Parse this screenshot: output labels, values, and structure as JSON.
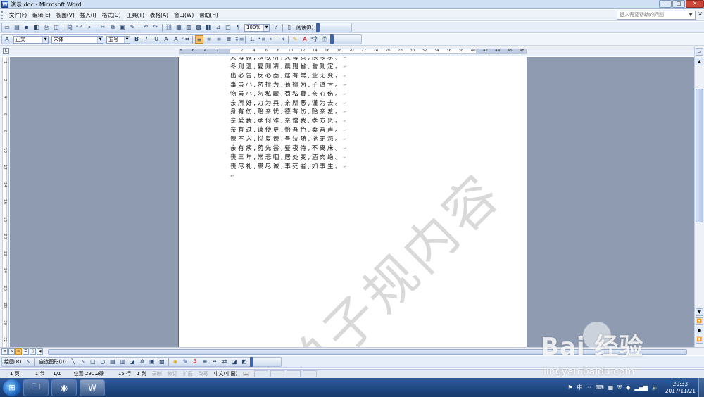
{
  "window": {
    "title": "演示.doc - Microsoft Word",
    "min": "–",
    "max": "□",
    "close": "✕"
  },
  "menu": {
    "items": [
      "文件(F)",
      "编辑(E)",
      "视图(V)",
      "插入(I)",
      "格式(O)",
      "工具(T)",
      "表格(A)",
      "窗口(W)",
      "帮助(H)"
    ],
    "help_placeholder": "键入需要帮助的问题",
    "close": "×"
  },
  "toolbar_standard": {
    "zoom": "100%",
    "read_label": "阅读(R)",
    "simp_trad": "简"
  },
  "toolbar_format": {
    "style": "正文",
    "font": "宋体",
    "size": "五号"
  },
  "ruler": {
    "ticks": [
      "8",
      "6",
      "4",
      "2",
      "",
      "2",
      "4",
      "6",
      "8",
      "10",
      "12",
      "14",
      "16",
      "18",
      "20",
      "22",
      "24",
      "26",
      "28",
      "30",
      "32",
      "34",
      "36",
      "38",
      "40",
      "42",
      "44",
      "46",
      "48"
    ]
  },
  "vruler": {
    "ticks": [
      "1",
      "2",
      "4",
      "6",
      "8",
      "10",
      "12",
      "14",
      "16",
      "18",
      "20",
      "22",
      "24",
      "26",
      "28",
      "30",
      "32"
    ]
  },
  "document": {
    "lines": [
      "父母教,须敬听,父母责,须顺承。",
      "冬则温,夏则凊,晨则省,昏则定。",
      "出必告,反必面,居有常,业无变。",
      "事虽小,勿擅为,苟擅为,子道亏。",
      "物虽小,勿私藏,苟私藏,亲心伤。",
      "亲所好,力为具,亲所恶,谨为去。",
      "身有伤,贻亲忧,德有伤,贻亲羞。",
      "亲爱我,孝何难,亲憎我,孝方贤。",
      "亲有过,谏使更,怡吾色,柔吾声。",
      "谏不入,悦复谏,号泣随,挞无怨。",
      "亲有疾,药先尝,昼夜侍,不离床。",
      "丧三年,常悲咽,居处变,酒肉绝。",
      "丧尽礼,祭尽诚,事死者,如事生。",
      ""
    ],
    "para_mark": "↵",
    "watermark": "弟子规内容"
  },
  "drawing_toolbar": {
    "draw": "绘图(R)",
    "autoshapes": "自选图形(U)"
  },
  "status": {
    "page": "1 页",
    "section": "1 节",
    "pages": "1/1",
    "position": "位置 290.2磅",
    "line": "15 行",
    "col": "1 列",
    "rec": "录制",
    "trk": "修订",
    "ext": "扩展",
    "ovr": "改写",
    "lang": "中文(中国)"
  },
  "taskbar": {
    "apps": [
      "explorer",
      "chrome",
      "word"
    ],
    "ime": "中",
    "time": "20:33",
    "date": "2017/11/21"
  },
  "overlay": {
    "baidu": "Bai 经验",
    "url": "jingyan.baidu.com"
  }
}
